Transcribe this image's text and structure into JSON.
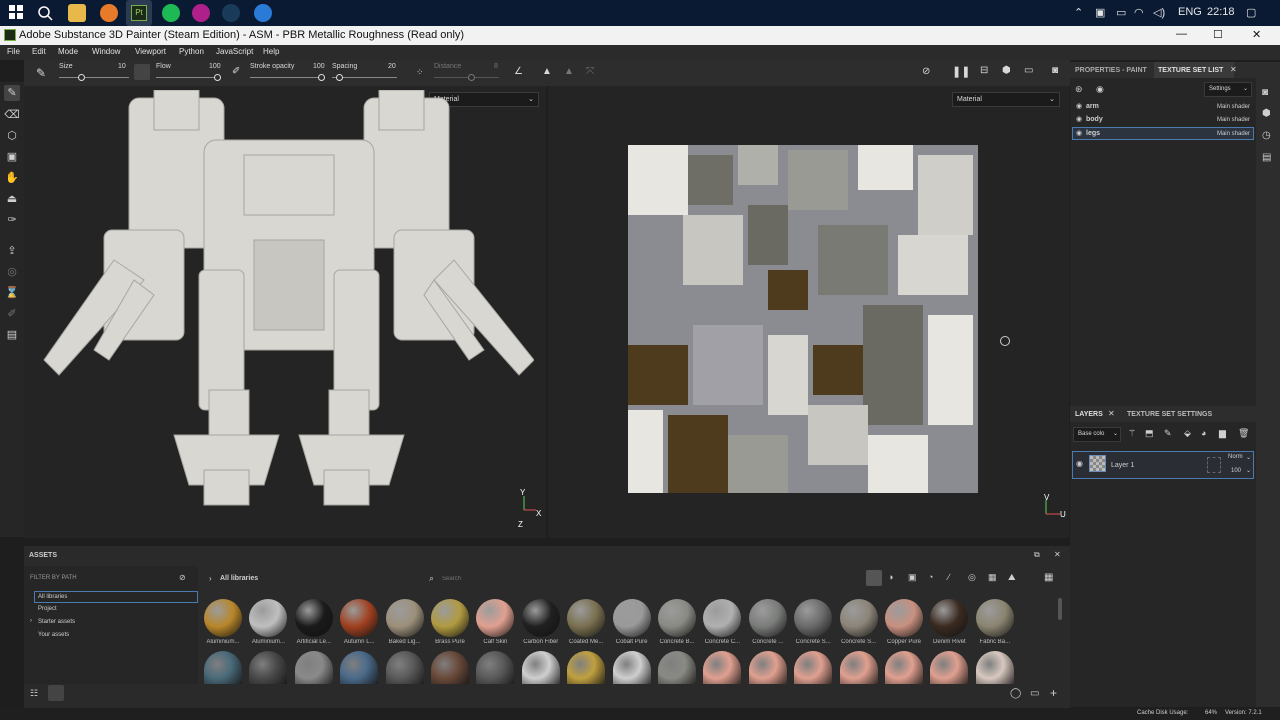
{
  "taskbar": {
    "language": "ENG",
    "time": "22:18"
  },
  "window": {
    "title": "Adobe Substance 3D Painter (Steam Edition) - ASM - PBR Metallic Roughness (Read only)",
    "minimize": "—",
    "maximize": "☐",
    "close": "✕"
  },
  "menu": [
    "File",
    "Edit",
    "Mode",
    "Window",
    "Viewport",
    "Python",
    "JavaScript",
    "Help"
  ],
  "toolbar": {
    "size_label": "Size",
    "size_value": "10",
    "flow_label": "Flow",
    "flow_value": "100",
    "stroke_label": "Stroke opacity",
    "stroke_value": "100",
    "spacing_label": "Spacing",
    "spacing_value": "20",
    "distance_label": "Distance",
    "distance_value": "8"
  },
  "viewport3d": {
    "material_select": "Material",
    "axis_y": "Y",
    "axis_x": "X",
    "axis_z": "Z"
  },
  "viewport2d": {
    "material_select": "Material",
    "axis_v": "V",
    "axis_u": "U"
  },
  "properties": {
    "tab_properties": "PROPERTIES - PAINT",
    "tab_texture_set_list": "TEXTURE SET LIST",
    "settings_button": "Settings",
    "texture_sets": [
      {
        "name": "arm",
        "shader": "Main shader"
      },
      {
        "name": "body",
        "shader": "Main shader"
      },
      {
        "name": "legs",
        "shader": "Main shader"
      }
    ]
  },
  "layers": {
    "tab_layers": "LAYERS",
    "tab_texture_set_settings": "TEXTURE SET SETTINGS",
    "channel_select": "Base colo",
    "layer_name": "Layer 1",
    "blend_mode": "Norm",
    "opacity": "100"
  },
  "assets": {
    "title": "ASSETS",
    "filter_label": "FILTER BY PATH",
    "breadcrumb": "All libraries",
    "search_placeholder": "Search",
    "tree": [
      "All libraries",
      "Project",
      "Starter assets",
      "Your assets"
    ],
    "materials_row1": [
      {
        "name": "Aluminium...",
        "color": "#b8862a"
      },
      {
        "name": "Aluminium...",
        "color": "#bfbfbf"
      },
      {
        "name": "Artificial Le...",
        "color": "#1a1a1a"
      },
      {
        "name": "Autumn L...",
        "color": "#a04020"
      },
      {
        "name": "Baked Lig...",
        "color": "#9c907a"
      },
      {
        "name": "Brass Pure",
        "color": "#b09a40"
      },
      {
        "name": "Calf Skin",
        "color": "#e0a090"
      },
      {
        "name": "Carbon Fiber",
        "color": "#202020"
      },
      {
        "name": "Coated Me...",
        "color": "#7a7050"
      },
      {
        "name": "Cobalt Pure",
        "color": "#9a9a9a"
      },
      {
        "name": "Concrete B...",
        "color": "#8a8a84"
      },
      {
        "name": "Concrete C...",
        "color": "#b0b0b0"
      },
      {
        "name": "Concrete ...",
        "color": "#7a7c7a"
      },
      {
        "name": "Concrete S...",
        "color": "#6a6a6a"
      },
      {
        "name": "Concrete S...",
        "color": "#8c8478"
      },
      {
        "name": "Copper Pure",
        "color": "#c89080"
      },
      {
        "name": "Denim Rivet",
        "color": "#3a2a20"
      },
      {
        "name": "Fabric Ba...",
        "color": "#8a8470"
      }
    ],
    "materials_row2": [
      "#4a6a7a",
      "#4a4a4a",
      "#8a8a8a",
      "#4a6a8a",
      "#5a5a5a",
      "#6a4a3a",
      "#5a5a5a",
      "#cfcfcf",
      "#c0a040",
      "#cfcfcf",
      "#8a8a84",
      "#e0a090",
      "#e0a090",
      "#e0a090",
      "#e0a090",
      "#e0a090",
      "#e0a090",
      "#d8c8c0"
    ]
  },
  "status": {
    "cache_label": "Cache Disk Usage:",
    "cache_value": "64%",
    "version": "Version: 7.2.1"
  }
}
